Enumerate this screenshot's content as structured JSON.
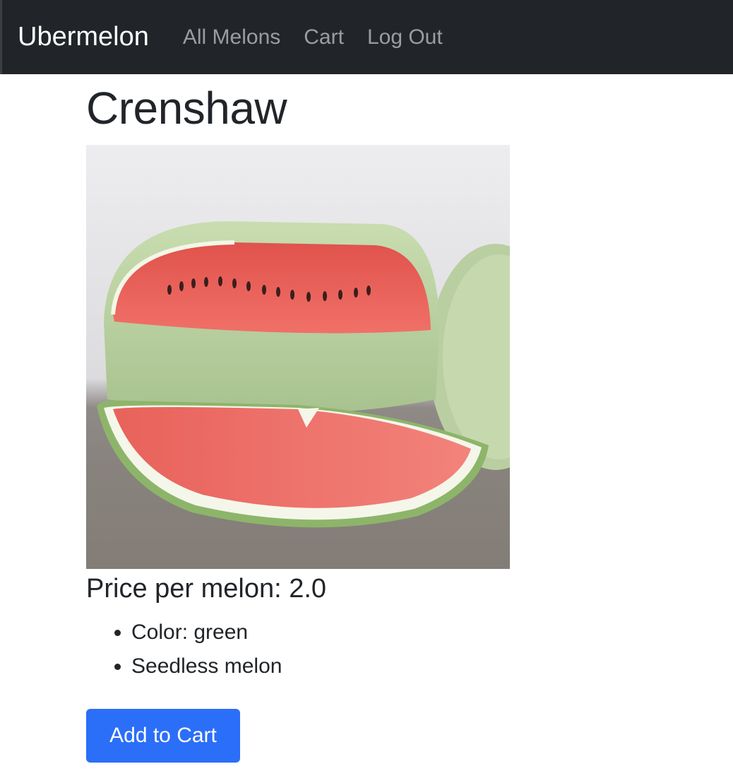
{
  "nav": {
    "brand": "Ubermelon",
    "links": [
      "All Melons",
      "Cart",
      "Log Out"
    ]
  },
  "melon": {
    "name": "Crenshaw",
    "image_alt": "watermelon-photo",
    "price_text": "Price per melon: 2.0",
    "features": [
      "Color: green",
      "Seedless melon"
    ]
  },
  "actions": {
    "add_to_cart": "Add to Cart"
  },
  "colors": {
    "navbar_bg": "#212529",
    "button_bg": "#2b6ef8"
  }
}
